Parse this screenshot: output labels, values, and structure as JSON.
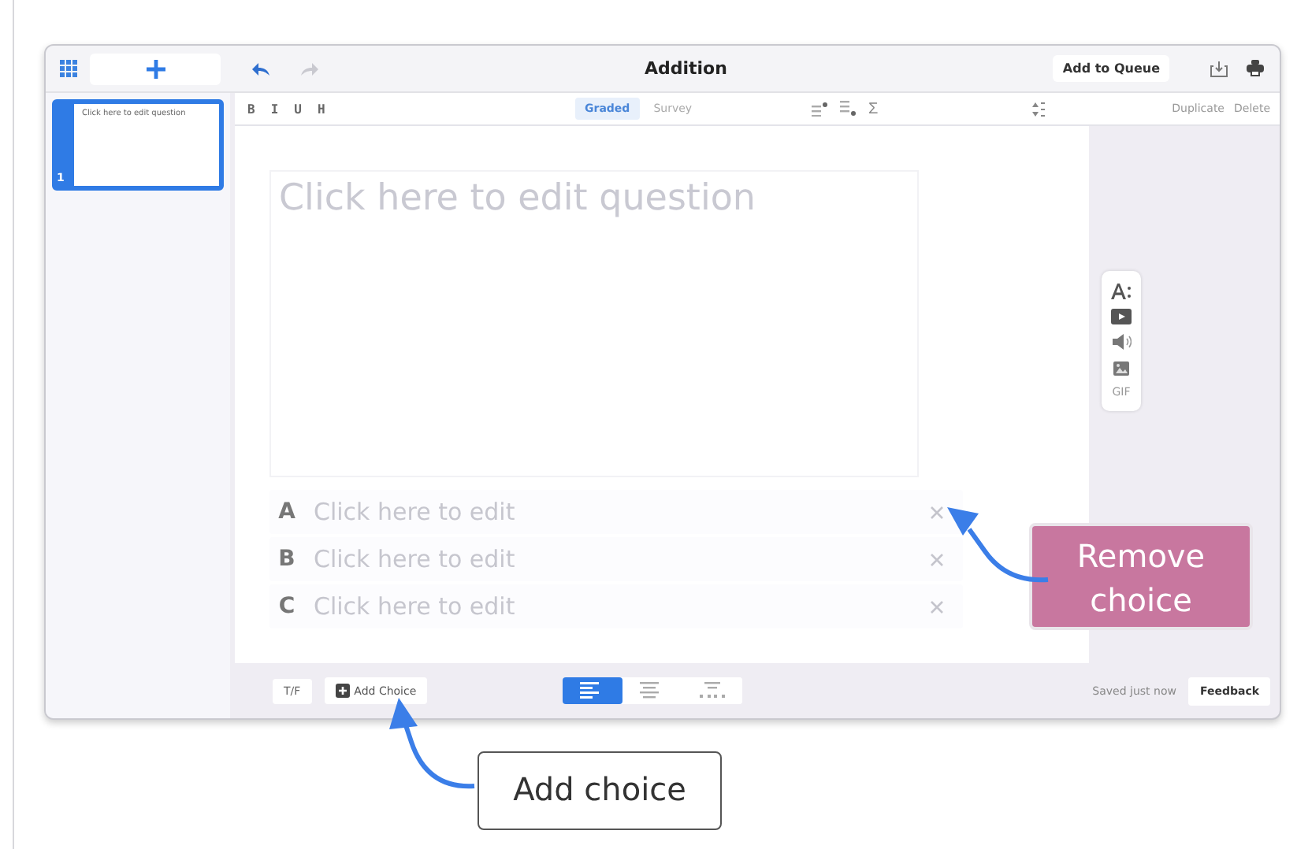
{
  "topbar": {
    "title": "Addition",
    "queue_button": "Add to Queue"
  },
  "slides": [
    {
      "number": "1",
      "preview": "Click here to edit question",
      "selected": true
    }
  ],
  "format_buttons": [
    "B",
    "I",
    "U",
    "H"
  ],
  "mode_tabs": [
    {
      "label": "Graded",
      "selected": true
    },
    {
      "label": "Survey",
      "selected": false
    }
  ],
  "math_symbol": "Σ",
  "actions": [
    "Duplicate",
    "Delete"
  ],
  "question": {
    "placeholder": "Click here to edit question"
  },
  "choices": [
    {
      "letter": "A",
      "placeholder": "Click here to edit"
    },
    {
      "letter": "B",
      "placeholder": "Click here to edit"
    },
    {
      "letter": "C",
      "placeholder": "Click here to edit"
    }
  ],
  "media_tools": [
    {
      "kind": "font"
    },
    {
      "kind": "video"
    },
    {
      "kind": "audio"
    },
    {
      "kind": "image"
    },
    {
      "kind": "gif",
      "label": "GIF"
    }
  ],
  "bottom_bar": {
    "tf_button": "T/F",
    "add_choice": "Add Choice",
    "layouts": [
      {
        "kind": "list",
        "selected": true
      },
      {
        "kind": "center",
        "selected": false
      },
      {
        "kind": "grid",
        "selected": false
      }
    ],
    "status": "Saved just now",
    "feedback": "Feedback"
  },
  "callouts": [
    {
      "kind": "accent",
      "text": "Remove choice"
    },
    {
      "kind": "plain",
      "text": "Add choice"
    }
  ]
}
